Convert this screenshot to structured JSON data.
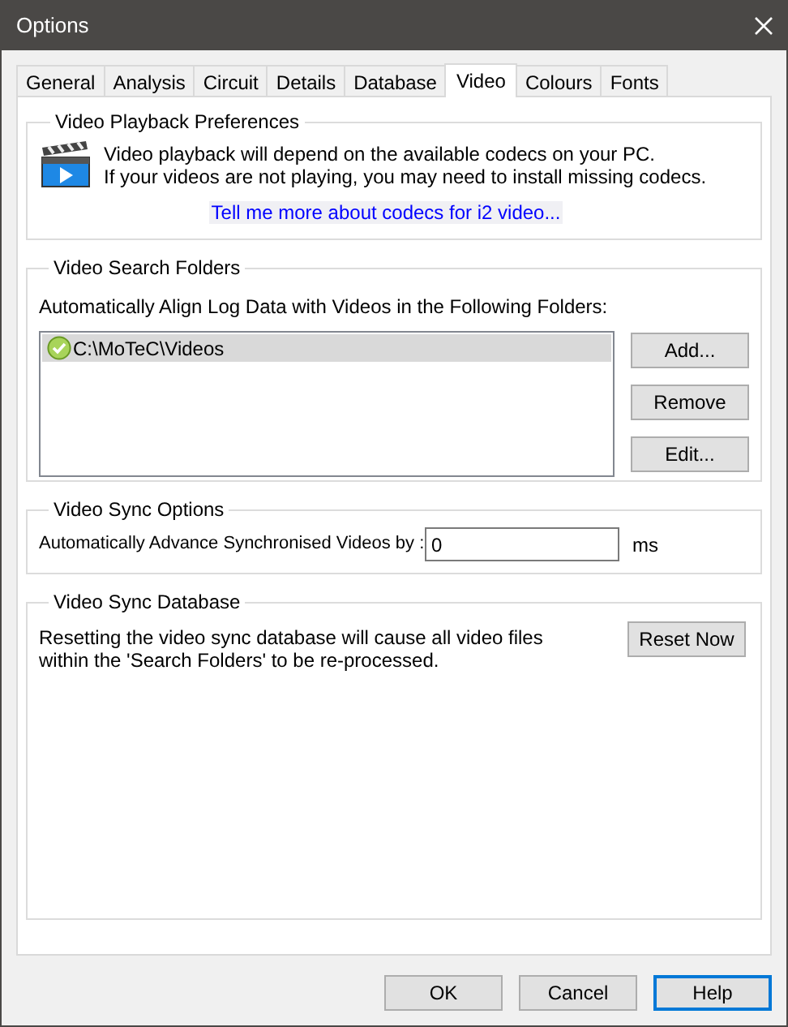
{
  "window": {
    "title": "Options"
  },
  "tabs": [
    {
      "label": "General",
      "selected": false
    },
    {
      "label": "Analysis",
      "selected": false
    },
    {
      "label": "Circuit",
      "selected": false
    },
    {
      "label": "Details",
      "selected": false
    },
    {
      "label": "Database",
      "selected": false
    },
    {
      "label": "Video",
      "selected": true
    },
    {
      "label": "Colours",
      "selected": false
    },
    {
      "label": "Fonts",
      "selected": false
    }
  ],
  "playback": {
    "legend": "Video Playback Preferences",
    "lines": [
      "Video playback will depend on the available codecs on your PC.",
      "If your videos are not playing, you may need to install missing codecs."
    ],
    "link": "Tell me more about codecs for i2 video..."
  },
  "search_folders": {
    "legend": "Video Search Folders",
    "label": "Automatically Align Log Data with Videos in the Following Folders:",
    "folders": [
      {
        "path": "C:\\MoTeC\\Videos",
        "selected": true
      }
    ],
    "buttons": [
      "Add...",
      "Remove",
      "Edit..."
    ]
  },
  "sync_options": {
    "legend": "Video Sync Options",
    "label": "Automatically Advance Synchronised Videos by :",
    "value": "0",
    "unit": "ms"
  },
  "sync_database": {
    "legend": "Video Sync Database",
    "lines": [
      "Resetting the video sync database will cause all video files",
      "within the 'Search Folders' to be re-processed."
    ],
    "button": "Reset Now"
  },
  "buttons": [
    {
      "label": "OK",
      "focused": false
    },
    {
      "label": "Cancel",
      "focused": false
    },
    {
      "label": "Help",
      "focused": true
    }
  ]
}
